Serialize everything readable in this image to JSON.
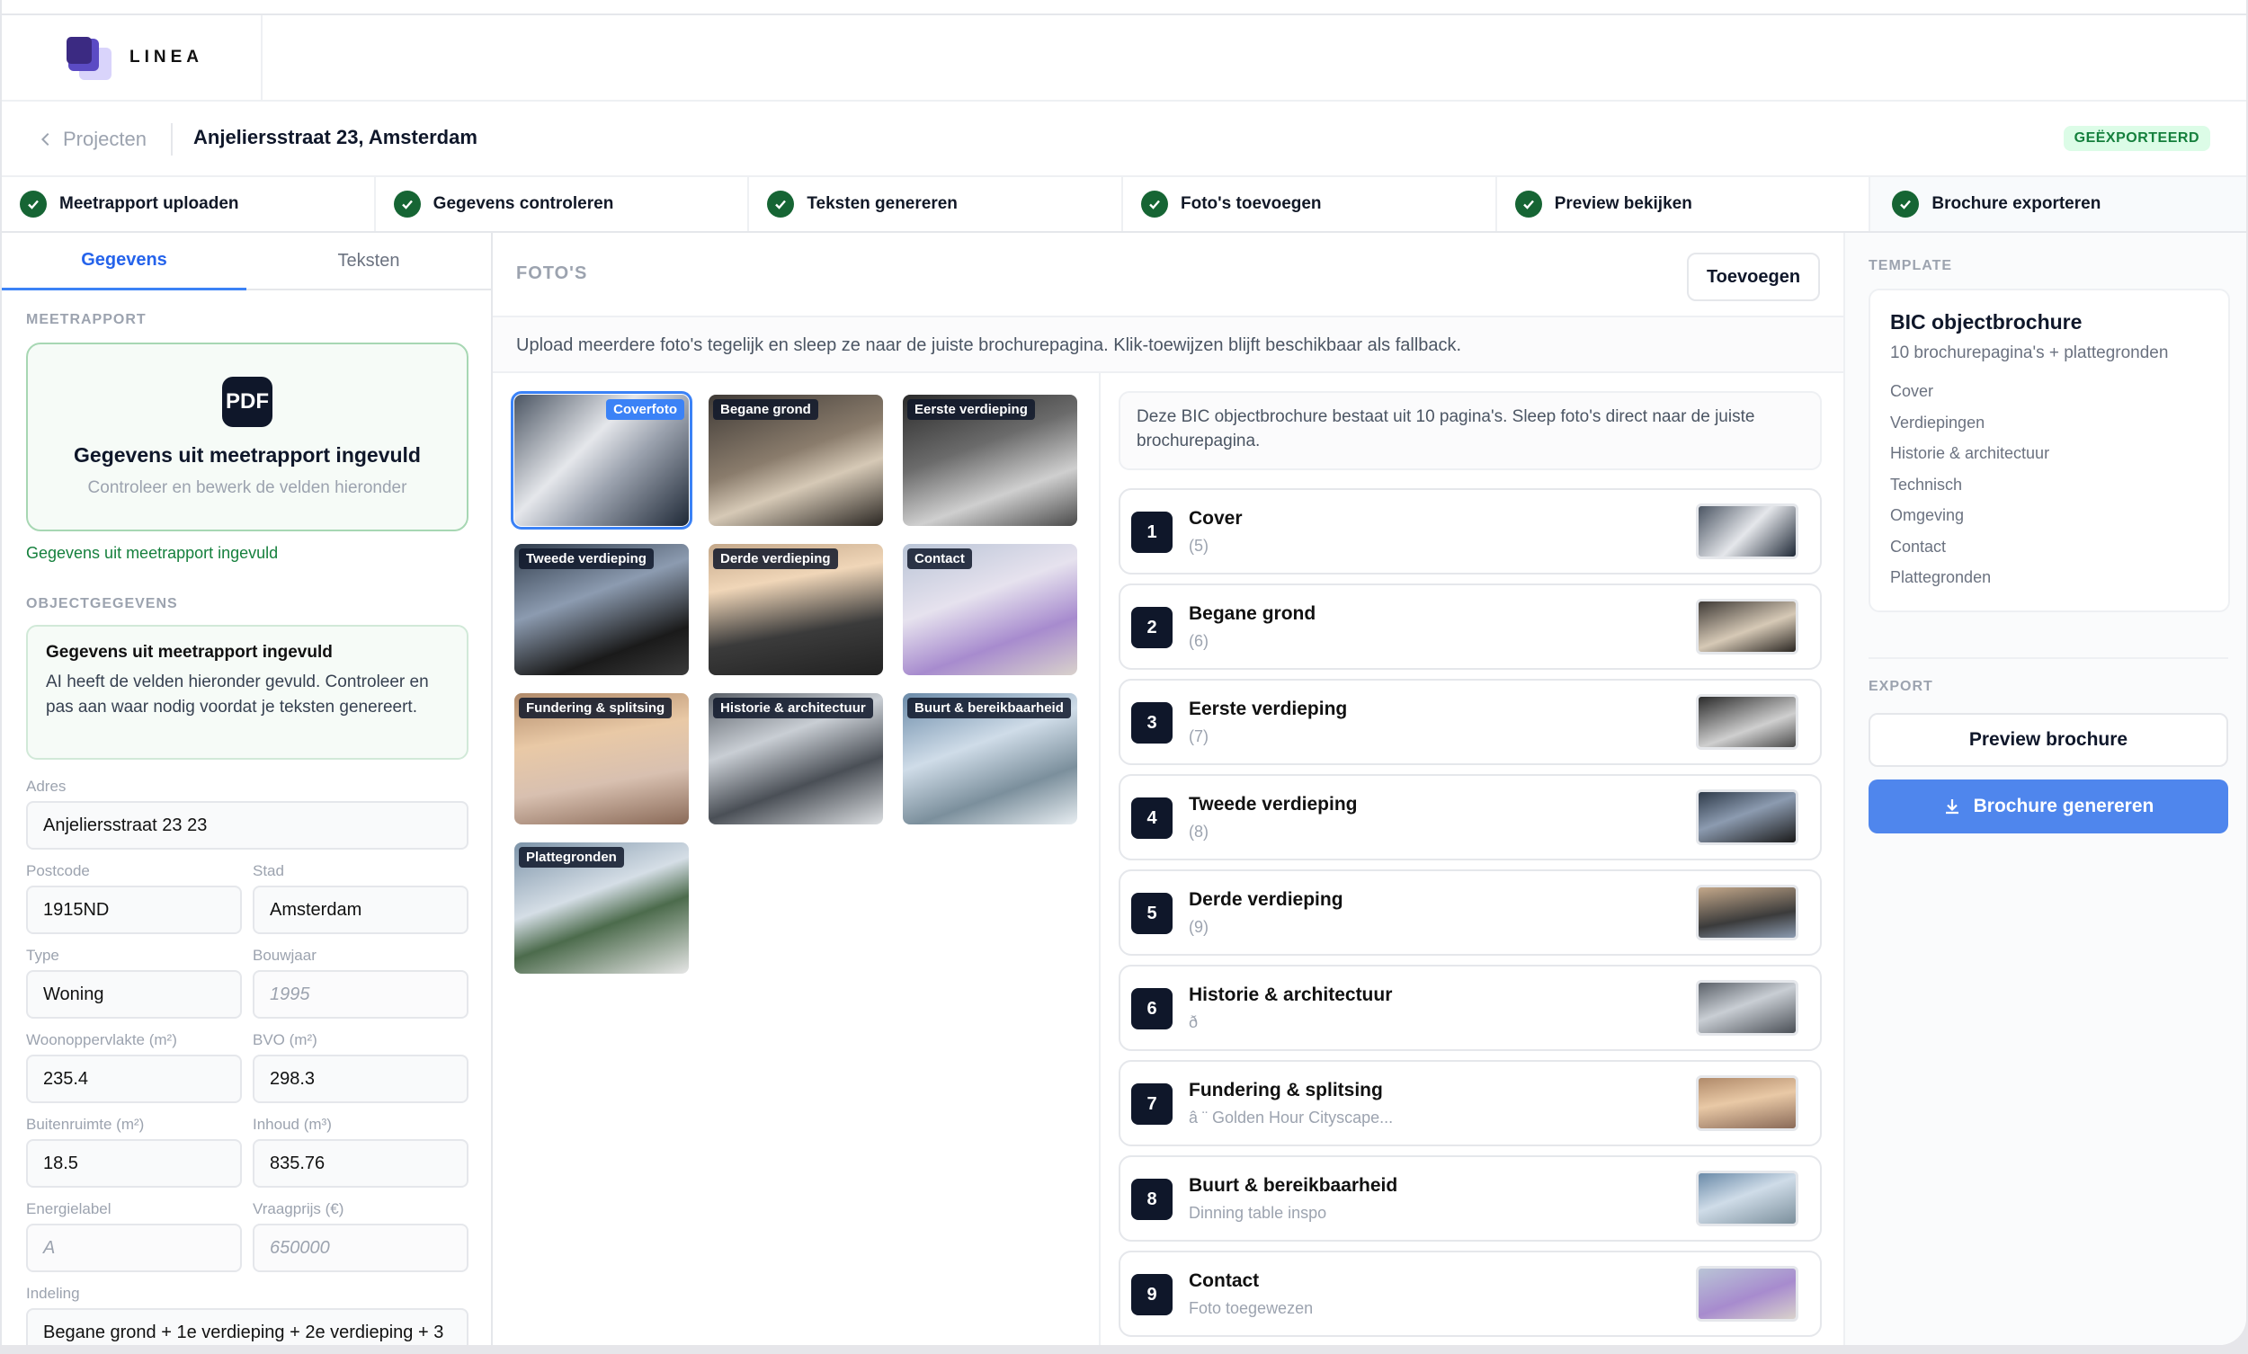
{
  "app": {
    "brand": "LINEA"
  },
  "breadcrumb": {
    "back_label": "Projecten",
    "title": "Anjeliersstraat 23, Amsterdam",
    "status": "GEËXPORTEERD"
  },
  "steps": [
    "Meetrapport uploaden",
    "Gegevens controleren",
    "Teksten genereren",
    "Foto's toevoegen",
    "Preview bekijken",
    "Brochure exporteren"
  ],
  "left": {
    "tabs": [
      "Gegevens",
      "Teksten"
    ],
    "meetrapport_label": "MEETRAPPORT",
    "pdf_icon": "PDF",
    "pdf_title": "Gegevens uit meetrapport ingevuld",
    "pdf_sub": "Controleer en bewerk de velden hieronder",
    "ok_line": "Gegevens uit meetrapport ingevuld",
    "object_label": "OBJECTGEGEVENS",
    "info_title": "Gegevens uit meetrapport ingevuld",
    "info_text": "AI heeft de velden hieronder gevuld. Controleer en pas aan waar nodig voordat je teksten genereert.",
    "fields": {
      "adres": {
        "label": "Adres",
        "value": "Anjeliersstraat 23 23"
      },
      "postcode": {
        "label": "Postcode",
        "value": "1915ND"
      },
      "stad": {
        "label": "Stad",
        "value": "Amsterdam"
      },
      "type": {
        "label": "Type",
        "value": "Woning"
      },
      "bouwjaar": {
        "label": "Bouwjaar",
        "placeholder": "1995"
      },
      "woon": {
        "label": "Woonoppervlakte (m²)",
        "value": "235.4"
      },
      "bvo": {
        "label": "BVO (m²)",
        "value": "298.3"
      },
      "buiten": {
        "label": "Buitenruimte (m²)",
        "value": "18.5"
      },
      "inhoud": {
        "label": "Inhoud (m³)",
        "value": "835.76"
      },
      "energie": {
        "label": "Energielabel",
        "placeholder": "A"
      },
      "prijs": {
        "label": "Vraagprijs (€)",
        "placeholder": "650000"
      },
      "indeling": {
        "label": "Indeling",
        "value": "Begane grond + 1e verdieping + 2e verdieping + 3"
      }
    }
  },
  "photos": {
    "section_label": "FOTO'S",
    "add_button": "Toevoegen",
    "hint": "Upload meerdere foto's tegelijk en sleep ze naar de juiste brochurepagina. Klik-toewijzen blijft beschikbaar als fallback.",
    "thumbs": [
      "Coverfoto",
      "Begane grond",
      "Eerste verdieping",
      "Tweede verdieping",
      "Derde verdieping",
      "Contact",
      "Fundering & splitsing",
      "Historie & architectuur",
      "Buurt & bereikbaarheid",
      "Plattegronden"
    ],
    "pages_info": "Deze BIC objectbrochure bestaat uit 10 pagina's. Sleep foto's direct naar de juiste brochurepagina.",
    "pages": [
      {
        "num": "1",
        "name": "Cover",
        "sub": "(5)"
      },
      {
        "num": "2",
        "name": "Begane grond",
        "sub": "(6)"
      },
      {
        "num": "3",
        "name": "Eerste verdieping",
        "sub": "(7)"
      },
      {
        "num": "4",
        "name": "Tweede verdieping",
        "sub": "(8)"
      },
      {
        "num": "5",
        "name": "Derde verdieping",
        "sub": "(9)"
      },
      {
        "num": "6",
        "name": "Historie & architectuur",
        "sub": "ð"
      },
      {
        "num": "7",
        "name": "Fundering & splitsing",
        "sub": "â  ¨ Golden Hour Cityscape..."
      },
      {
        "num": "8",
        "name": "Buurt & bereikbaarheid",
        "sub": "Dinning table inspo"
      },
      {
        "num": "9",
        "name": "Contact",
        "sub": "Foto toegewezen"
      }
    ]
  },
  "template": {
    "label": "TEMPLATE",
    "title": "BIC objectbrochure",
    "sub": "10 brochurepagina's + plattegronden",
    "items": [
      "Cover",
      "Verdiepingen",
      "Historie & architectuur",
      "Technisch",
      "Omgeving",
      "Contact",
      "Plattegronden"
    ]
  },
  "export": {
    "label": "EXPORT",
    "preview": "Preview brochure",
    "generate": "Brochure genereren"
  },
  "colors": {
    "accent": "#3b82f6",
    "success": "#166534",
    "dark": "#0f172a"
  }
}
